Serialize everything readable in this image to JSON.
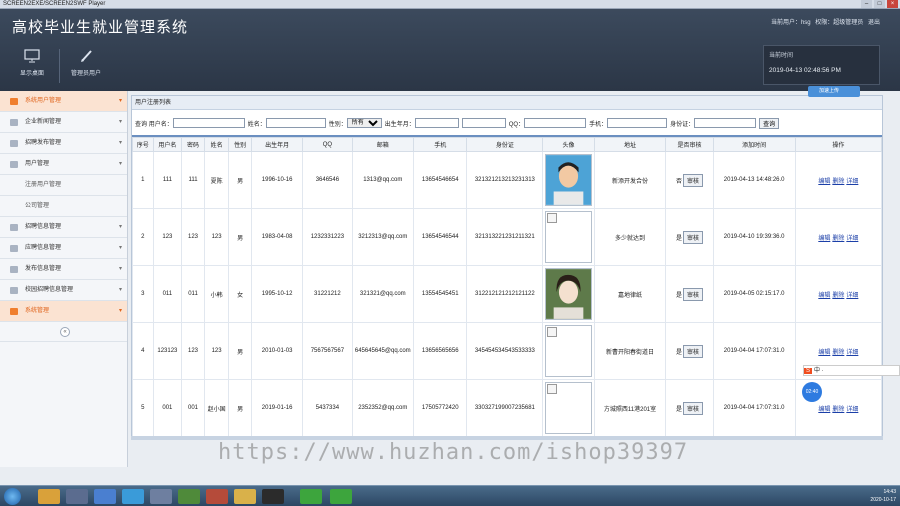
{
  "window": {
    "title": "SCREEN2EXE/SCREEN2SWF Player",
    "buttons": [
      "–",
      "□",
      "×"
    ]
  },
  "header": {
    "app_title": "高校毕业生就业管理系统",
    "user_label": "当前用户：hsg",
    "role_label": "权限：超级管理员",
    "logout_label": "退出",
    "tools": [
      {
        "label": "显示桌面",
        "icon": "monitor-icon"
      },
      {
        "label": "管理员用户",
        "icon": "pencil-icon"
      }
    ],
    "time_label": "当前时间",
    "time_value": "2019-04-13 02:48:56 PM"
  },
  "sidebar": {
    "items": [
      {
        "label": "系统用户管理",
        "icon": "user-icon",
        "active": true
      },
      {
        "label": "企业新闻管理",
        "icon": "news-icon"
      },
      {
        "label": "招聘发布管理",
        "icon": "recruit-icon"
      },
      {
        "label": "用户管理",
        "icon": "users-icon"
      },
      {
        "label": "注册用户管理",
        "sub": true
      },
      {
        "label": "公司管理",
        "sub": true
      },
      {
        "label": "招聘信息管理",
        "icon": "info-icon"
      },
      {
        "label": "应聘信息管理",
        "icon": "apply-icon"
      },
      {
        "label": "发布信息管理",
        "icon": "publish-icon"
      },
      {
        "label": "校园招聘信息管理",
        "icon": "campus-icon"
      },
      {
        "label": "系统管理",
        "icon": "settings-icon",
        "active": true
      }
    ],
    "collapse_symbol": "«"
  },
  "main": {
    "breadcrumb": "用户注册列表",
    "search": {
      "query_label": "查询",
      "username_label": "用户名：",
      "name_label": "姓名：",
      "gender_label": "性别：",
      "gender_selected": "所有",
      "birth_label": "出生年月：",
      "qq_label": "QQ：",
      "phone_label": "手机：",
      "id_label": "身份证：",
      "search_button": "查询"
    },
    "columns": [
      "序号",
      "用户名",
      "密码",
      "姓名",
      "性别",
      "出生年月",
      "QQ",
      "邮箱",
      "手机",
      "身份证",
      "头像",
      "地址",
      "是否审核",
      "添加时间",
      "操作"
    ],
    "audit_button": "审核",
    "actions": [
      "编辑",
      "删除",
      "详细"
    ],
    "rows": [
      {
        "no": "1",
        "username": "111",
        "password": "111",
        "name": "夏陈",
        "gender": "男",
        "birth": "1996-10-16",
        "qq": "3646546",
        "email": "1313@qq.com",
        "phone": "13654546654",
        "idcard": "321321213213231313",
        "avatar": "photo-boy",
        "address": "新添开发合份",
        "audited": "否",
        "added": "2019-04-13 14:48:26.0"
      },
      {
        "no": "2",
        "username": "123",
        "password": "123",
        "name": "123",
        "gender": "男",
        "birth": "1983-04-08",
        "qq": "1232331223",
        "email": "3212313@qq.com",
        "phone": "13654546544",
        "idcard": "321313221231211321",
        "avatar": "broken",
        "address": "多少就达到",
        "audited": "是",
        "added": "2019-04-10 19:39:36.0"
      },
      {
        "no": "3",
        "username": "011",
        "password": "011",
        "name": "小韩",
        "gender": "女",
        "birth": "1995-10-12",
        "qq": "31221212",
        "email": "321321@qq.com",
        "phone": "13554545451",
        "idcard": "312212121212121122",
        "avatar": "photo-girl",
        "address": "嘉地律纸",
        "audited": "是",
        "added": "2019-04-05 02:15:17.0"
      },
      {
        "no": "4",
        "username": "123123",
        "password": "123",
        "name": "123",
        "gender": "男",
        "birth": "2010-01-03",
        "qq": "7567567567",
        "email": "645645645@qq.com",
        "phone": "13656565656",
        "idcard": "345454534543533333",
        "avatar": "broken",
        "address": "新曹开阳春街道日",
        "audited": "是",
        "added": "2019-04-04 17:07:31.0"
      },
      {
        "no": "5",
        "username": "001",
        "password": "001",
        "name": "赵小国",
        "gender": "男",
        "birth": "2019-01-16",
        "qq": "5437334",
        "email": "2352352@qq.com",
        "phone": "17505772420",
        "idcard": "330327199007235681",
        "avatar": "broken",
        "address": "方城照西11港201室",
        "audited": "是",
        "added": "2019-04-04 17:07:31.0"
      }
    ]
  },
  "watermark": "https://www.huzhan.com/ishop39397",
  "cloud_badge": "加速上传",
  "ime_bar": "中 ·",
  "bubble": "02:40",
  "taskbar": {
    "time": "14:43",
    "date": "2020-10-17"
  },
  "colors": {
    "header": "#2f3b4c",
    "accent": "#e0641c",
    "table_border": "#6b8fc0",
    "link": "#1b3fa8"
  }
}
